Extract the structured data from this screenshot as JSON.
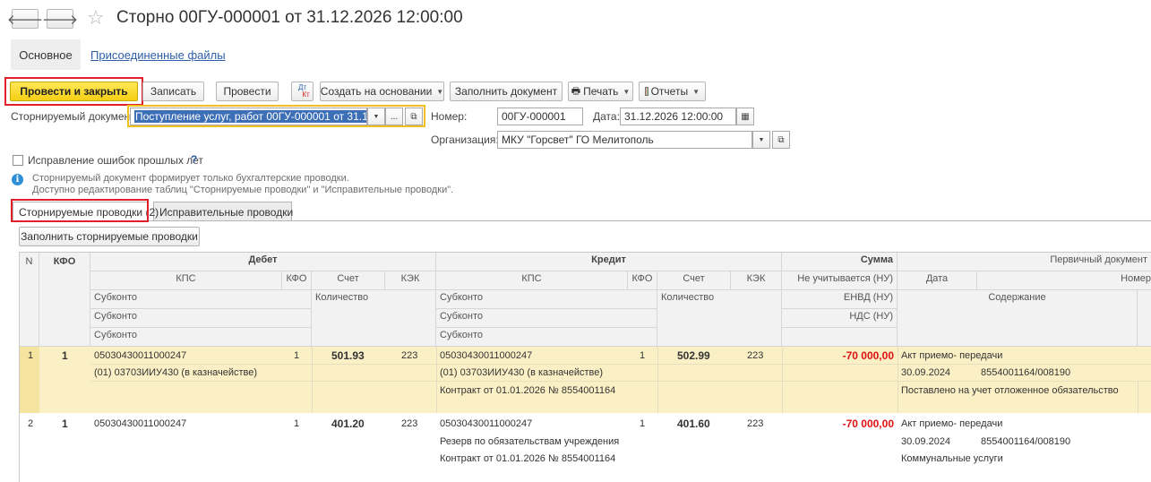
{
  "window": {
    "title": "Сторно 00ГУ-000001 от 31.12.2026 12:00:00",
    "back_symbol": "🡐",
    "forward_symbol": "🡒",
    "favorite_icon": "star-icon"
  },
  "sections": {
    "main": "Основное",
    "files": "Присоединенные файлы"
  },
  "toolbar": {
    "post_close": "Провести и закрыть",
    "save": "Записать",
    "post": "Провести",
    "dt_kt_top": "Дт",
    "dt_kt_bottom": "Кт",
    "create_based": "Создать на основании",
    "fill_doc": "Заполнить документ",
    "print": "Печать",
    "reports": "Отчеты"
  },
  "form": {
    "reversed_doc_label": "Сторнируемый документ:",
    "reversed_doc_value": "Поступление услуг, работ 00ГУ-000001 от 31.12.20",
    "number_label": "Номер:",
    "number_value": "00ГУ-000001",
    "date_label": "Дата:",
    "date_value": "31.12.2026 12:00:00",
    "org_label": "Организация:",
    "org_value": "МКУ \"Горсвет\" ГО Мелитополь",
    "fix_errors_label": "Исправление ошибок прошлых лет",
    "help_mark": "?",
    "info_line1": "Сторнируемый документ формирует только бухгалтерские проводки.",
    "info_line2": "Доступно редактирование таблиц \"Сторнируемые проводки\" и \"Исправительные проводки\".",
    "info_glyph": "i",
    "dots": "..."
  },
  "tabs": {
    "reversed": "Сторнируемые проводки (2)",
    "corrective": "Исправительные проводки"
  },
  "fill_reversed_btn": "Заполнить сторнируемые проводки",
  "grid": {
    "headers": {
      "n": "N",
      "kfo": "КФО",
      "debit": "Дебет",
      "credit": "Кредит",
      "sum": "Сумма",
      "primary_doc": "Первичный документ",
      "kps": "КПС",
      "kfo_sub": "КФО",
      "account": "Счет",
      "kek": "КЭК",
      "subkonto": "Субконто",
      "quantity": "Количество",
      "not_counted": "Не учитывается (НУ)",
      "envd": "ЕНВД (НУ)",
      "nds": "НДС (НУ)",
      "date": "Дата",
      "number": "Номер",
      "content": "Содержание"
    },
    "rows": [
      {
        "n": "1",
        "kfo": "1",
        "d_kps": "05030430011000247",
        "d_kfo": "1",
        "d_account": "501.93",
        "d_kek": "223",
        "d_sub1": "(01) 03703ИИУ430 (в казначействе)",
        "c_kps": "05030430011000247",
        "c_kfo": "1",
        "c_account": "502.99",
        "c_kek": "223",
        "c_sub1": "(01) 03703ИИУ430 (в казначействе)",
        "c_sub2": "Контракт от 01.01.2026 № 8554001164",
        "sum": "-70 000,00",
        "doc_type": "Акт приемо- передачи",
        "doc_date": "30.09.2024",
        "doc_number": "8554001164/008190",
        "content": "Поставлено на учет отложенное обязательство"
      },
      {
        "n": "2",
        "kfo": "1",
        "d_kps": "05030430011000247",
        "d_kfo": "1",
        "d_account": "401.20",
        "d_kek": "223",
        "d_sub1": "",
        "c_kps": "05030430011000247",
        "c_kfo": "1",
        "c_account": "401.60",
        "c_kek": "223",
        "c_sub1": "Резерв по обязательствам учреждения",
        "c_sub2": "Контракт от 01.01.2026 № 8554001164",
        "sum": "-70 000,00",
        "doc_type": "Акт приемо- передачи",
        "doc_date": "30.09.2024",
        "doc_number": "8554001164/008190",
        "content": "Коммунальные услуги"
      }
    ]
  }
}
